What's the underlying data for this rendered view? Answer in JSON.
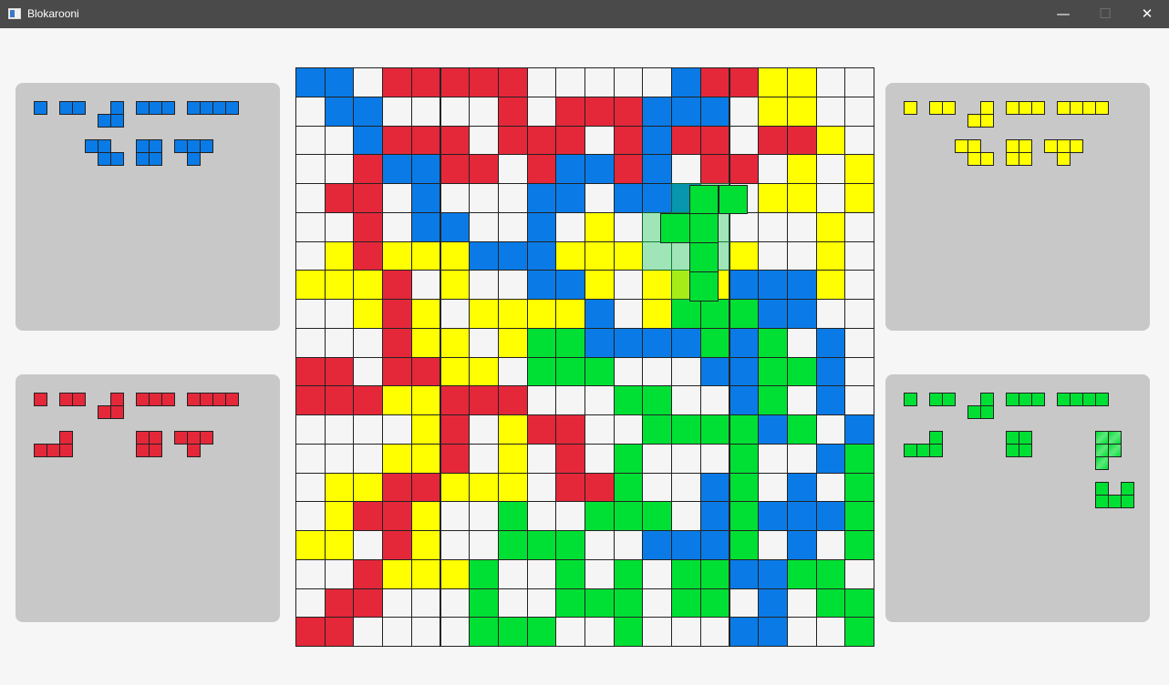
{
  "window": {
    "title": "Blokarooni",
    "minimize_glyph": "—",
    "maximize_glyph": "☐",
    "close_glyph": "✕",
    "app_icon": "window-icon"
  },
  "colors": {
    "blue": "#0a7be6",
    "red": "#e4283a",
    "yellow": "#ffff00",
    "green": "#00e034",
    "empty": "#f5f5f5",
    "ghost": "#8fe6a4",
    "panel": "#c8c8c8",
    "background": "#f6f6f6"
  },
  "board": {
    "size": 20,
    "legend": {
      ".": "empty",
      "B": "blue",
      "R": "red",
      "Y": "yellow",
      "G": "green"
    },
    "rows": [
      "BB.RRRRR.....BRRYY",
      ".BB....R.RRRBBB.YY",
      "..BRRR.RRR.RBRR.RRY.",
      "..RBBRR.RBBRB.RR.Y.Y",
      ".RR.B...BB.BBB..YY.Y",
      "..R.BB..B.Y.......Y",
      ".YRYYYBBBYYY...Y..Y",
      "YYYR.Y..BBY.YYYBBBY",
      "..YRY.YYYYB.YGGGBB..",
      "...RYY.YGGBBBBGBG.B.",
      "RR.RRYY.GGG...BBGGB.",
      "RRRYYRRR...GG..BG.B.",
      "....YR.YRR..GGGGBG.BG",
      "...YYR.Y.R.G...G..BG",
      ".YYRRYYY.RRG..BG.B.G",
      ".YRRY..G..GGG.BGBBBG",
      "YY.RY..GGG..BBBG.B.G",
      "..RYYYG..G.G.GGBBGG.",
      ".RR...G..GGG.GG.B.GG",
      "RR....GGG..G...BB..G"
    ],
    "ghost_cells": [
      [
        13,
        4
      ],
      [
        14,
        4
      ],
      [
        13,
        5
      ],
      [
        14,
        5
      ],
      [
        12,
        5
      ],
      [
        12,
        6
      ],
      [
        13,
        6
      ],
      [
        14,
        6
      ],
      [
        13,
        7
      ]
    ],
    "cursor_piece": {
      "color": "green",
      "cells": [
        [
          14,
          4.3
        ],
        [
          15,
          4.3
        ],
        [
          14,
          5.3
        ],
        [
          13,
          5.3
        ],
        [
          14,
          6.3
        ],
        [
          14,
          7.3
        ]
      ]
    }
  },
  "players": [
    {
      "id": "blue",
      "color": "blue",
      "panel": "top-left",
      "pieces": [
        {
          "name": "monomino",
          "cells": [
            [
              0,
              0
            ]
          ]
        },
        {
          "name": "domino",
          "cells": [
            [
              0,
              0
            ],
            [
              1,
              0
            ]
          ]
        },
        {
          "name": "v-tromino",
          "cells": [
            [
              1,
              0
            ],
            [
              0,
              1
            ],
            [
              1,
              1
            ]
          ]
        },
        {
          "name": "i-tromino",
          "cells": [
            [
              0,
              0
            ],
            [
              1,
              0
            ],
            [
              2,
              0
            ]
          ]
        },
        {
          "name": "i-tetromino",
          "cells": [
            [
              0,
              0
            ],
            [
              1,
              0
            ],
            [
              2,
              0
            ],
            [
              3,
              0
            ]
          ]
        },
        {
          "name": "s-tetromino",
          "cells": [
            [
              0,
              0
            ],
            [
              1,
              0
            ],
            [
              1,
              1
            ],
            [
              2,
              1
            ]
          ]
        },
        {
          "name": "o-tetromino",
          "cells": [
            [
              0,
              0
            ],
            [
              1,
              0
            ],
            [
              0,
              1
            ],
            [
              1,
              1
            ]
          ]
        },
        {
          "name": "t-tetromino",
          "cells": [
            [
              0,
              0
            ],
            [
              1,
              0
            ],
            [
              2,
              0
            ],
            [
              1,
              1
            ]
          ]
        }
      ]
    },
    {
      "id": "yellow",
      "color": "yellow",
      "panel": "top-right",
      "pieces": [
        {
          "name": "monomino",
          "cells": [
            [
              0,
              0
            ]
          ]
        },
        {
          "name": "domino",
          "cells": [
            [
              0,
              0
            ],
            [
              1,
              0
            ]
          ]
        },
        {
          "name": "v-tromino",
          "cells": [
            [
              1,
              0
            ],
            [
              0,
              1
            ],
            [
              1,
              1
            ]
          ]
        },
        {
          "name": "i-tromino",
          "cells": [
            [
              0,
              0
            ],
            [
              1,
              0
            ],
            [
              2,
              0
            ]
          ]
        },
        {
          "name": "i-tetromino",
          "cells": [
            [
              0,
              0
            ],
            [
              1,
              0
            ],
            [
              2,
              0
            ],
            [
              3,
              0
            ]
          ]
        },
        {
          "name": "s-tetromino",
          "cells": [
            [
              0,
              0
            ],
            [
              1,
              0
            ],
            [
              1,
              1
            ],
            [
              2,
              1
            ]
          ]
        },
        {
          "name": "o-tetromino",
          "cells": [
            [
              0,
              0
            ],
            [
              1,
              0
            ],
            [
              0,
              1
            ],
            [
              1,
              1
            ]
          ]
        },
        {
          "name": "t-tetromino",
          "cells": [
            [
              0,
              0
            ],
            [
              1,
              0
            ],
            [
              2,
              0
            ],
            [
              1,
              1
            ]
          ]
        }
      ]
    },
    {
      "id": "red",
      "color": "red",
      "panel": "bottom-left",
      "pieces": [
        {
          "name": "monomino",
          "cells": [
            [
              0,
              0
            ]
          ]
        },
        {
          "name": "domino",
          "cells": [
            [
              0,
              0
            ],
            [
              1,
              0
            ]
          ]
        },
        {
          "name": "v-tromino",
          "cells": [
            [
              1,
              0
            ],
            [
              0,
              1
            ],
            [
              1,
              1
            ]
          ]
        },
        {
          "name": "i-tromino",
          "cells": [
            [
              0,
              0
            ],
            [
              1,
              0
            ],
            [
              2,
              0
            ]
          ]
        },
        {
          "name": "i-tetromino",
          "cells": [
            [
              0,
              0
            ],
            [
              1,
              0
            ],
            [
              2,
              0
            ],
            [
              3,
              0
            ]
          ]
        },
        {
          "name": "l-tetromino",
          "cells": [
            [
              2,
              0
            ],
            [
              0,
              1
            ],
            [
              1,
              1
            ],
            [
              2,
              1
            ]
          ]
        },
        {
          "name": "o-tetromino",
          "cells": [
            [
              0,
              0
            ],
            [
              1,
              0
            ],
            [
              0,
              1
            ],
            [
              1,
              1
            ]
          ]
        },
        {
          "name": "t-tetromino",
          "cells": [
            [
              0,
              0
            ],
            [
              1,
              0
            ],
            [
              2,
              0
            ],
            [
              1,
              1
            ]
          ]
        }
      ]
    },
    {
      "id": "green",
      "color": "green",
      "panel": "bottom-right",
      "pieces": [
        {
          "name": "monomino",
          "cells": [
            [
              0,
              0
            ]
          ]
        },
        {
          "name": "domino",
          "cells": [
            [
              0,
              0
            ],
            [
              1,
              0
            ]
          ]
        },
        {
          "name": "v-tromino",
          "cells": [
            [
              1,
              0
            ],
            [
              0,
              1
            ],
            [
              1,
              1
            ]
          ]
        },
        {
          "name": "i-tromino",
          "cells": [
            [
              0,
              0
            ],
            [
              1,
              0
            ],
            [
              2,
              0
            ]
          ]
        },
        {
          "name": "i-tetromino",
          "cells": [
            [
              0,
              0
            ],
            [
              1,
              0
            ],
            [
              2,
              0
            ],
            [
              3,
              0
            ]
          ]
        },
        {
          "name": "l-tetromino",
          "cells": [
            [
              2,
              0
            ],
            [
              0,
              1
            ],
            [
              1,
              1
            ],
            [
              2,
              1
            ]
          ]
        },
        {
          "name": "o-tetromino",
          "cells": [
            [
              0,
              0
            ],
            [
              1,
              0
            ],
            [
              0,
              1
            ],
            [
              1,
              1
            ]
          ]
        },
        {
          "name": "selected-piece-outline",
          "cells": [
            [
              0,
              0
            ],
            [
              1,
              0
            ],
            [
              0,
              1
            ],
            [
              1,
              1
            ],
            [
              0,
              2
            ]
          ]
        },
        {
          "name": "u-pentomino",
          "cells": [
            [
              0,
              0
            ],
            [
              2,
              0
            ],
            [
              0,
              1
            ],
            [
              1,
              1
            ],
            [
              2,
              1
            ]
          ]
        }
      ]
    }
  ]
}
